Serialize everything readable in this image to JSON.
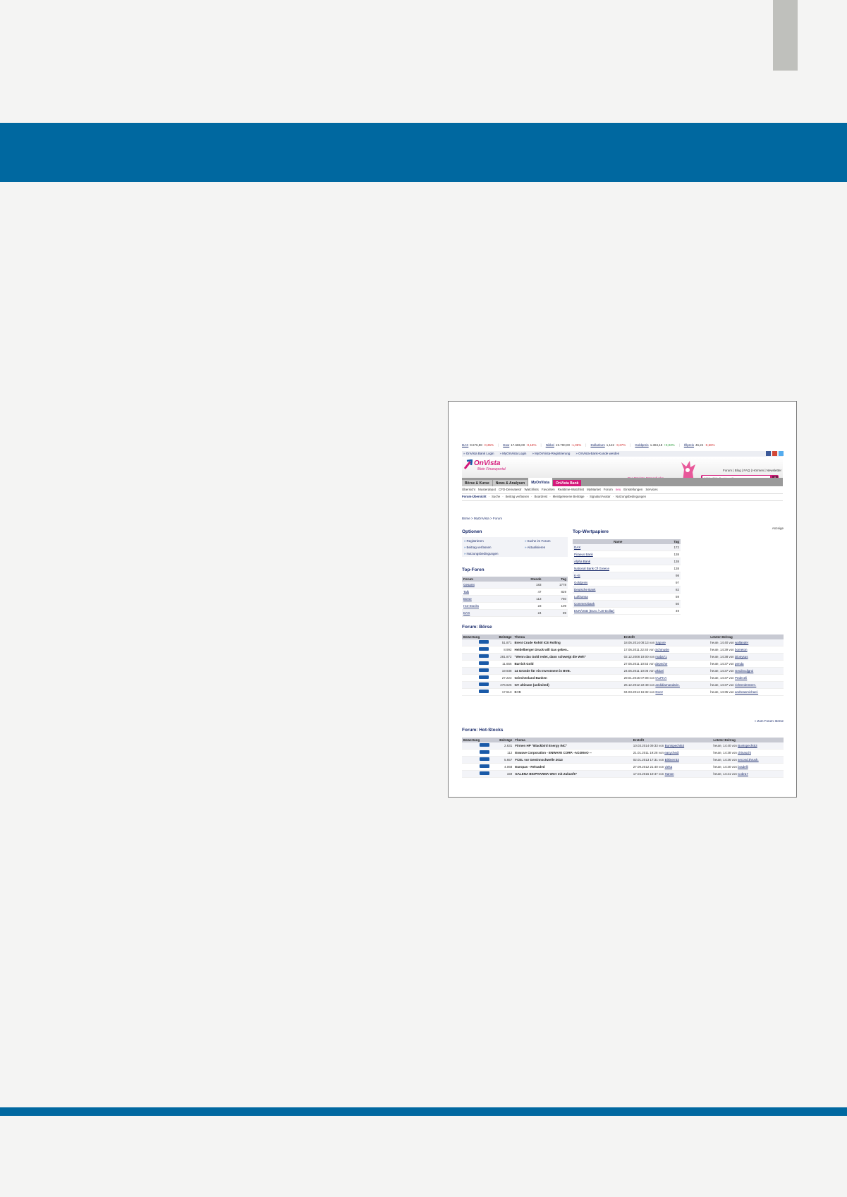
{
  "screenshot": {
    "ticker": [
      {
        "name": "DAX",
        "value": "9.676,88",
        "change": "-0,35%",
        "dir": "neg"
      },
      {
        "name": "Dow",
        "value": "17.686,00",
        "change": "-0,18%",
        "dir": "neg"
      },
      {
        "name": "Nikkei",
        "value": "19.790,00",
        "change": "-1,06%",
        "dir": "neg"
      },
      {
        "name": "Dollarkurs",
        "value": "1,122",
        "change": "-0,37%",
        "dir": "neg"
      },
      {
        "name": "Goldpreis",
        "value": "1.384,18",
        "change": "+0,03%",
        "dir": "pos"
      },
      {
        "name": "Ölpreis",
        "value": "46,24",
        "change": "-0,66%",
        "dir": "neg"
      }
    ],
    "toplinks": [
      "» OnVista Bank Login",
      "» MyOnVista Login",
      "» MyOnVista-Registrierung",
      "» OnVista-Bank-Kunde werden"
    ],
    "logo": {
      "name": "OnVista",
      "slogan": "Mein Finanzportal"
    },
    "util_links": "Forum | Blog | FAQ | Hörmen | Newsletter",
    "promo_link": "Der OnVista-Börsenfuchs",
    "search_placeholder": "WKN, ISIN, Suchbegriff",
    "main_tabs": [
      "Börse & Kurse",
      "News & Analysen",
      "MyOnVista",
      "OnVista Bank"
    ],
    "sub_nav": [
      "Übersicht",
      "Musterdepot",
      "CFD-Derivatestr",
      "Watchlists",
      "Favoriten",
      "Realtime-Watchlist",
      "MyMarket",
      "Forum",
      "Einstellungen",
      "Services"
    ],
    "sub_nav_new": "neu",
    "forum_nav": [
      "Forum-Übersicht",
      "Suche",
      "Beitrag verfassen",
      "Boardrest",
      "Meistgelesene Beiträge",
      "Signatur/Avatar",
      "Nutzungsbedingungen"
    ],
    "breadcrumb": "Börse > MyOnVista > Forum",
    "anzeige": "Anzeige",
    "options": {
      "title": "Optionen",
      "items": [
        "Registrieren",
        "Beitrag verfassen",
        "Nutzungsbedingungen",
        "Suche im Forum",
        "Aktualisieren"
      ]
    },
    "top_foren": {
      "title": "Top-Foren",
      "headers": [
        "Forum",
        "Stunde",
        "Tag"
      ],
      "rows": [
        [
          "Gesamt",
          "183",
          "1778"
        ],
        [
          "Talk",
          "47",
          "829"
        ],
        [
          "Börse",
          "113",
          "760"
        ],
        [
          "Hot-Stocks",
          "23",
          "109"
        ],
        [
          "DAX",
          "24",
          "89"
        ]
      ]
    },
    "top_wertpapiere": {
      "title": "Top-Wertpapiere",
      "headers": [
        "Name",
        "Tag"
      ],
      "rows": [
        [
          "DAX",
          "172"
        ],
        [
          "Piraeus Bank",
          "138"
        ],
        [
          "Alpha Bank",
          "138"
        ],
        [
          "National Bank Of Greece",
          "138"
        ],
        [
          "K+S",
          "98"
        ],
        [
          "Goldpreis",
          "97"
        ],
        [
          "Deutsche Bank",
          "82"
        ],
        [
          "Lufthansa",
          "59"
        ],
        [
          "Commerzbank",
          "50"
        ],
        [
          "EUR/USD (Euro / US-Dollar)",
          "49"
        ]
      ]
    },
    "forum_boerse": {
      "title": "Forum: Börse",
      "headers": [
        "Bewertung",
        "Beiträge",
        "Thema",
        "Erstellt",
        "Letzter Beitrag"
      ],
      "rows": [
        [
          "51.871",
          "Brent Crude Rohöl ICE Rolling",
          "18.06.2014 08:13 von",
          "Sapore",
          "heute, 14:40 von",
          "wallander"
        ],
        [
          "8.992",
          "Heidelberger Druck will Gas geben..",
          "17.06.2011 22:40 von",
          "Schmusle",
          "heute, 14:39 von",
          "bometon"
        ],
        [
          "281.872",
          "\"Wenn das Gold redet, dann schweigt die Welt\"",
          "02.12.2008 19:00 von",
          "maba71",
          "heute, 14:38 von",
          "Dionysus"
        ],
        [
          "11.656",
          "Barrick Gold",
          "27.05.2011 10:53 von",
          "depeche",
          "heute, 14:37 von",
          "penda"
        ],
        [
          "19.938",
          "14 Gründe für ein Investment in BVB.",
          "24.05.2011 10:06 von",
          "aktiari",
          "heute, 14:37 von",
          "Geulincdjgroi"
        ],
        [
          "27.223",
          "Griechenland Banken",
          "29.01.2015 07:08 von",
          "tALPHA",
          "heute, 14:37 von",
          "Pedeceli"
        ],
        [
          "276.626",
          "GV ultimate (unlimited)",
          "26.12.2012 22:48 von",
          "andidiamandarin.",
          "heute, 14:37 von",
          "richterdemtern."
        ],
        [
          "17.513",
          "K+S",
          "04.03.2014 16:32 von",
          "Doc2",
          "heute, 14:35 von",
          "andreasmichael."
        ]
      ]
    },
    "zum_forum_boerse": "» Zum Forum: Börse",
    "forum_hotstocks": {
      "title": "Forum: Hot-Stocks",
      "headers": [
        "Bewertung",
        "Beiträge",
        "Thema",
        "Erstellt",
        "Letzter Beitrag"
      ],
      "rows": [
        [
          "2.631",
          "Firmen HP \"Blackbird Energy INC\"",
          "10.03.2014 09:33 von",
          "Buntspecht53",
          "heute, 14:40 von",
          "Buntspecht53"
        ],
        [
          "112",
          "Enwave Corporation - ENWAVE CORP. -AOJMAO --",
          "21.01.2011 19:28 von",
          "easychedi",
          "heute, 14:38 von",
          "chinaschi"
        ],
        [
          "5.657",
          "FCEL vor Gewinnschwelle 2013",
          "02.01.2013 17:31 von",
          "Bikinerr33",
          "heute, 14:36 von",
          "second.thrush."
        ],
        [
          "4.068",
          "Europas - Reloaded",
          "27.09.2012 21:40 von",
          "vieka",
          "heute, 14:30 von",
          "bradelli"
        ],
        [
          "159",
          "GALENA BIOPHARMA-Wert mit Zukunft?",
          "17.04.2015 19:47 von",
          "Hansn",
          "heute, 14:21 von",
          "Cobra7"
        ]
      ]
    }
  },
  "colors": {
    "band": "#0068a0",
    "brand": "#d4187a",
    "link": "#1a2b6b"
  }
}
